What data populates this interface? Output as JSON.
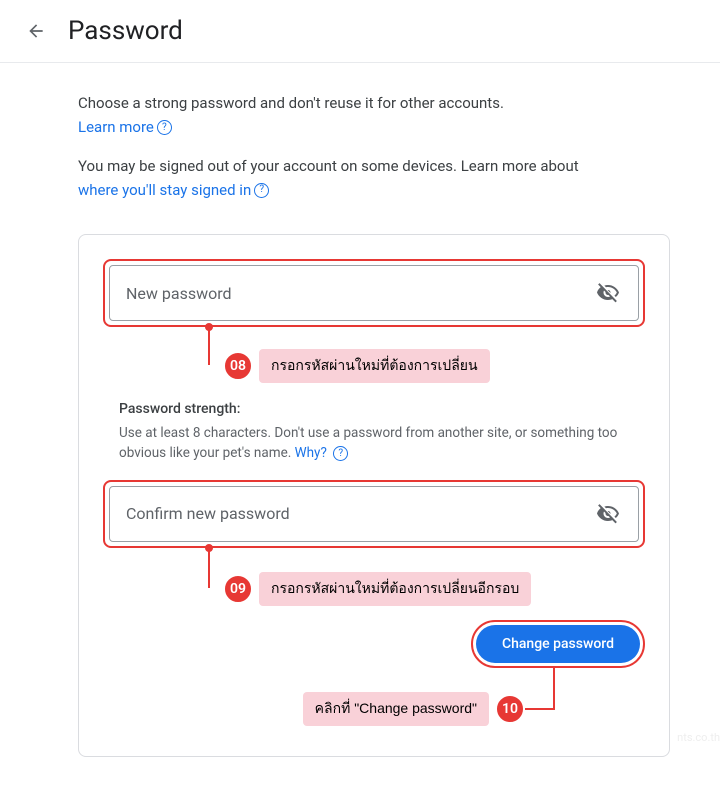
{
  "header": {
    "title": "Password"
  },
  "description": {
    "line1": "Choose a strong password and don't reuse it for other accounts.",
    "learn_more": "Learn more",
    "line2_pre": "You may be signed out of your account on some devices. Learn more about ",
    "line2_link": "where you'll stay signed in"
  },
  "form": {
    "new_password_placeholder": "New password",
    "confirm_password_placeholder": "Confirm new password",
    "strength_title": "Password strength:",
    "strength_text": "Use at least 8 characters. Don't use a password from another site, or something too obvious like your pet's name. ",
    "why_label": "Why?",
    "change_button": "Change password"
  },
  "callouts": {
    "c08_num": "08",
    "c08_text": "กรอกรหัสผ่านใหม่ที่ต้องการเปลี่ยน",
    "c09_num": "09",
    "c09_text": "กรอกรหัสผ่านใหม่ที่ต้องการเปลี่ยนอีกรอบ",
    "c10_num": "10",
    "c10_text": "คลิกที่ \"Change password\""
  },
  "watermark": "nts.co.th"
}
